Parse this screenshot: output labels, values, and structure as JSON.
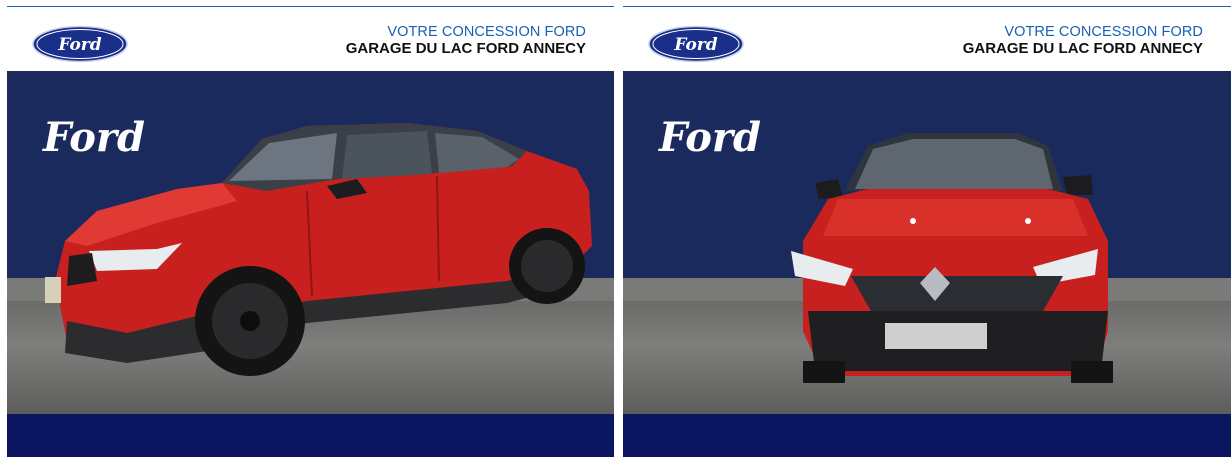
{
  "brand": {
    "oval_logo_icon": "ford-oval-logo-icon",
    "script_logo_icon": "ford-script-logo-icon",
    "colors": {
      "accent_blue": "#1a5fb4",
      "stage_navy": "#1b2a5c",
      "footer_navy": "#0a1660",
      "car_red": "#c8201f"
    }
  },
  "panels": [
    {
      "dealer_line1": "VOTRE CONCESSION FORD",
      "dealer_line2": "GARAGE DU LAC FORD ANNECY",
      "view": "side-three-quarter"
    },
    {
      "dealer_line1": "VOTRE CONCESSION FORD",
      "dealer_line2": "GARAGE DU LAC FORD ANNECY",
      "view": "front"
    }
  ]
}
